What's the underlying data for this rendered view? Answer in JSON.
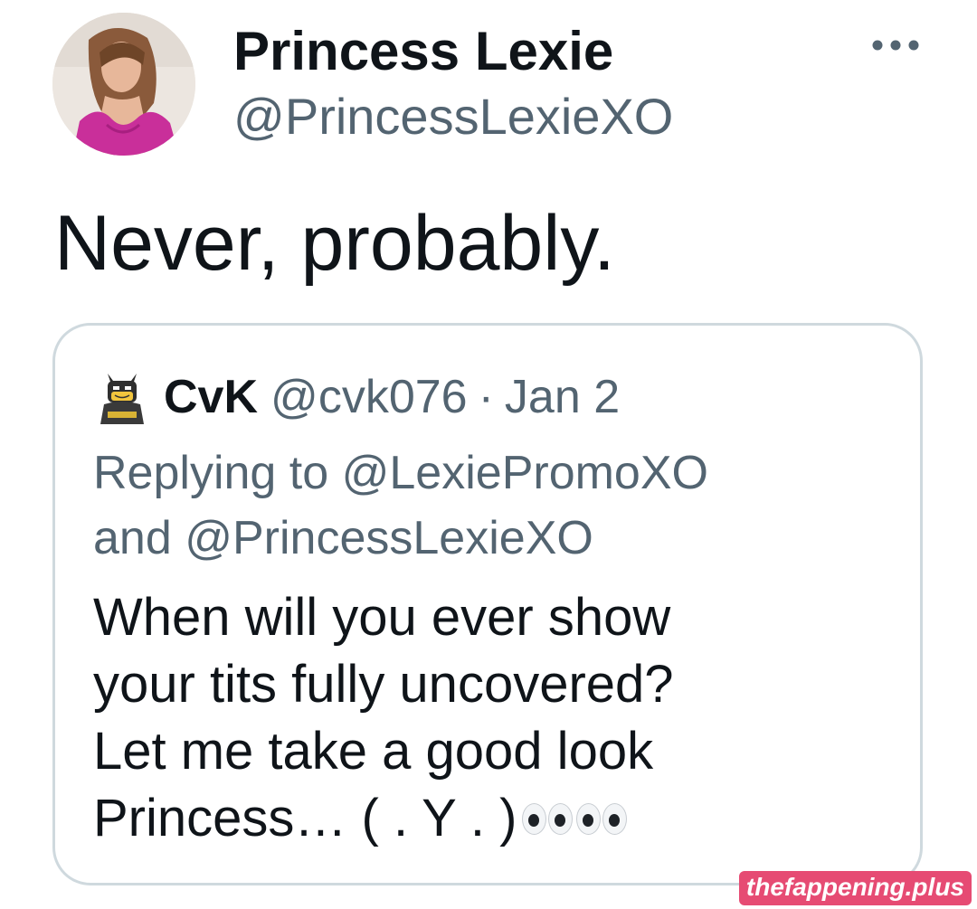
{
  "tweet": {
    "author": {
      "display_name": "Princess Lexie",
      "handle": "@PrincessLexieXO",
      "avatar_icon": "profile-photo"
    },
    "more_icon": "ellipsis-icon",
    "text": "Never, probably."
  },
  "quoted_tweet": {
    "author": {
      "display_name": "CvK",
      "handle": "@cvk076",
      "avatar_icon": "lego-batman-icon"
    },
    "separator": "·",
    "date": "Jan 2",
    "replying_line1": "Replying to @LexiePromoXO",
    "replying_line2": "and @PrincessLexieXO",
    "text_lines": [
      "When will you ever show",
      "your tits fully uncovered?",
      "Let me take a good look",
      "Princess…  ( .  Y  . )"
    ],
    "trailing_icon": "eyes-emoji"
  },
  "watermark": "thefappening.plus",
  "colors": {
    "text_primary": "#0f1419",
    "text_secondary": "#536471",
    "card_border": "#cfd9de"
  }
}
